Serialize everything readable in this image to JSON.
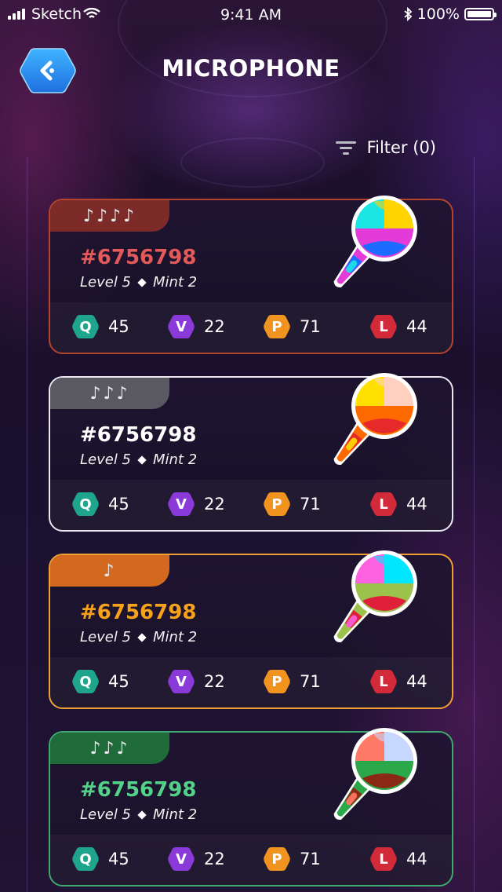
{
  "status": {
    "carrier": "Sketch",
    "time": "9:41 AM",
    "battery": "100%"
  },
  "header": {
    "title": "MICROPHONE"
  },
  "filter": {
    "label": "Filter (0)"
  },
  "cards": [
    {
      "rarity_notes": "♪♪♪♪",
      "code": "#6756798",
      "level": "Level 5",
      "mint": "Mint 2",
      "stats": {
        "q": "45",
        "v": "22",
        "p": "71",
        "l": "44"
      },
      "border_color": "#b4442e",
      "tab_color": "#7c2b28",
      "code_color": "#e25a5a",
      "mic_colors": [
        "#ffd400",
        "#1be6e6",
        "#e23bd8",
        "#1e6cff"
      ]
    },
    {
      "rarity_notes": "♪♪♪",
      "code": "#6756798",
      "level": "Level 5",
      "mint": "Mint 2",
      "stats": {
        "q": "45",
        "v": "22",
        "p": "71",
        "l": "44"
      },
      "border_color": "#e8e8ee",
      "tab_color": "#5a5860",
      "code_color": "#ffffff",
      "mic_colors": [
        "#ffd0c0",
        "#ffe000",
        "#ff6a00",
        "#e62a2a"
      ]
    },
    {
      "rarity_notes": "♪",
      "code": "#6756798",
      "level": "Level 5",
      "mint": "Mint 2",
      "stats": {
        "q": "45",
        "v": "22",
        "p": "71",
        "l": "44"
      },
      "border_color": "#f0a032",
      "tab_color": "#d2691e",
      "code_color": "#f7a21b",
      "mic_colors": [
        "#00e6ff",
        "#ff62e0",
        "#9bc24a",
        "#e0203a"
      ]
    },
    {
      "rarity_notes": "♪♪♪",
      "code": "#6756798",
      "level": "Level 5",
      "mint": "Mint 2",
      "stats": {
        "q": "45",
        "v": "22",
        "p": "71",
        "l": "44"
      },
      "border_color": "#3fa870",
      "tab_color": "#1f6b3a",
      "code_color": "#55d28a",
      "mic_colors": [
        "#c6d8ff",
        "#ff7a66",
        "#2aa84a",
        "#8a2a14"
      ]
    }
  ],
  "stat_badges": {
    "q": {
      "letter": "Q",
      "color": "#1fa58b"
    },
    "v": {
      "letter": "V",
      "color": "#8a3ad9"
    },
    "p": {
      "letter": "P",
      "color": "#f0931f"
    },
    "l": {
      "letter": "L",
      "color": "#d32a3a"
    }
  },
  "icons": {
    "back": "chevron-left-icon",
    "filter": "filter-lines-icon",
    "bluetooth": "bluetooth-icon",
    "wifi": "wifi-icon"
  }
}
